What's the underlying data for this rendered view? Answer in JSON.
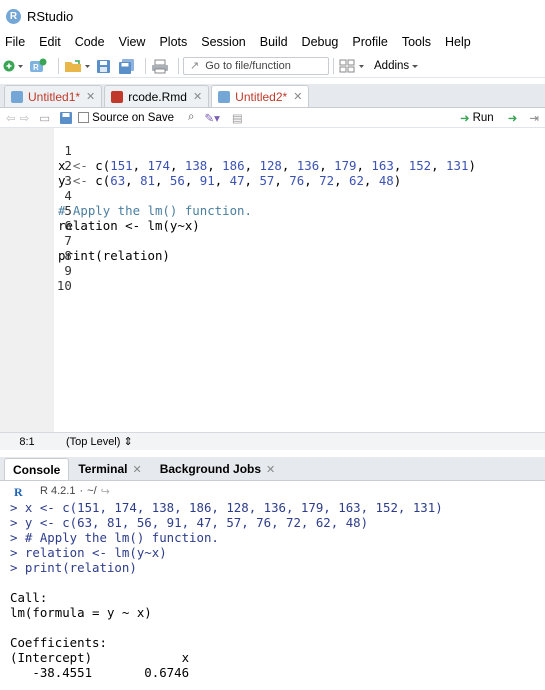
{
  "window": {
    "title": "RStudio",
    "logo_letter": "R"
  },
  "menu": [
    "File",
    "Edit",
    "Code",
    "View",
    "Plots",
    "Session",
    "Build",
    "Debug",
    "Profile",
    "Tools",
    "Help"
  ],
  "toolbar": {
    "goto_placeholder": "Go to file/function",
    "addins_label": "Addins"
  },
  "editor_tabs": [
    {
      "label": "Untitled1*",
      "modified": true,
      "active": false,
      "icon_color": "#75a7d6"
    },
    {
      "label": "rcode.Rmd",
      "modified": false,
      "active": false,
      "icon_color": "#c0392b"
    },
    {
      "label": "Untitled2*",
      "modified": true,
      "active": true,
      "icon_color": "#75a7d6"
    }
  ],
  "editor_toolbar": {
    "source_on_save": "Source on Save",
    "run": "Run"
  },
  "editor": {
    "line_numbers": [
      "1",
      "2",
      "3",
      "4",
      "5",
      "6",
      "7",
      "8",
      "9",
      "10"
    ],
    "lines": [
      "x <- c(151, 174, 138, 186, 128, 136, 179, 163, 152, 131)",
      "y <- c(63, 81, 56, 91, 47, 57, 76, 72, 62, 48)",
      "",
      "# Apply the lm() function.",
      "relation <- lm(y~x)",
      "",
      "print(relation)",
      "",
      "",
      ""
    ]
  },
  "editor_status": {
    "position": "8:1",
    "scope": "(Top Level)"
  },
  "console_tabs": [
    "Console",
    "Terminal",
    "Background Jobs"
  ],
  "console": {
    "r_version": "R 4.2.1",
    "path": "~/",
    "lines": [
      {
        "text": "> x <- c(151, 174, 138, 186, 128, 136, 179, 163, 152, 131)",
        "kind": "cmd"
      },
      {
        "text": "> y <- c(63, 81, 56, 91, 47, 57, 76, 72, 62, 48)",
        "kind": "cmd"
      },
      {
        "text": "> # Apply the lm() function.",
        "kind": "cmd"
      },
      {
        "text": "> relation <- lm(y~x)",
        "kind": "cmd"
      },
      {
        "text": "> print(relation)",
        "kind": "cmd"
      },
      {
        "text": "",
        "kind": "out"
      },
      {
        "text": "Call:",
        "kind": "out"
      },
      {
        "text": "lm(formula = y ~ x)",
        "kind": "out"
      },
      {
        "text": "",
        "kind": "out"
      },
      {
        "text": "Coefficients:",
        "kind": "out"
      },
      {
        "text": "(Intercept)            x",
        "kind": "out"
      },
      {
        "text": "   -38.4551       0.6746",
        "kind": "out"
      }
    ]
  }
}
